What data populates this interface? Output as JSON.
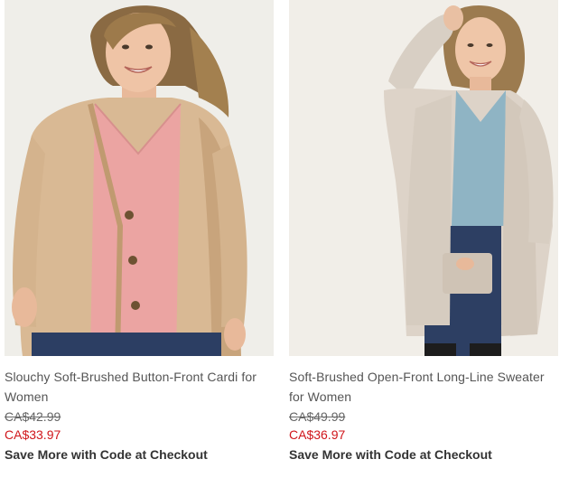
{
  "products": [
    {
      "title_line1": "Slouchy Soft-Brushed Button-Front Cardi for",
      "title_line2": "Women",
      "original_price": "CA$42.99",
      "sale_price": "CA$33.97",
      "promo": "Save More with Code at Checkout"
    },
    {
      "title_line1": "Soft-Brushed Open-Front Long-Line Sweater",
      "title_line2": "for Women",
      "original_price": "CA$49.99",
      "sale_price": "CA$36.97",
      "promo": "Save More with Code at Checkout"
    }
  ],
  "colors": {
    "sale_price": "#d0161b",
    "title": "#555555",
    "promo": "#333333"
  }
}
